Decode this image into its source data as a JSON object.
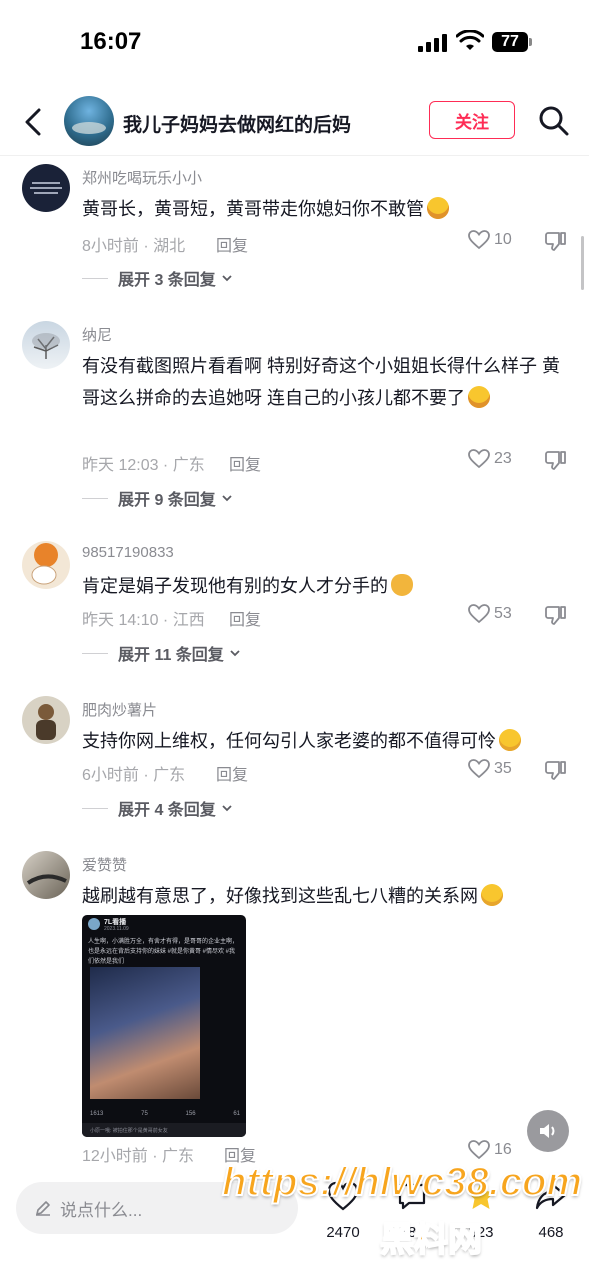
{
  "status_bar": {
    "time": "16:07",
    "battery": "77"
  },
  "header": {
    "title": "我儿子妈妈去做网红的后妈",
    "follow_label": "关注"
  },
  "comments": [
    {
      "user": "郑州吃喝玩乐小小",
      "text": "黄哥长，黄哥短，黄哥带走你媳妇你不敢管",
      "emoji": "rofl-emoji",
      "meta": "8小时前 · 湖北",
      "reply": "回复",
      "likes": "10",
      "expand": "展开 3 条回复"
    },
    {
      "user": "纳尼",
      "text": "有没有截图照片看看啊  特别好奇这个小姐姐长得什么样子  黄哥这么拼命的去追她呀 连自己的小孩儿都不要了",
      "emoji": "grimace-emoji",
      "meta": "昨天 12:03 · 广东",
      "reply": "回复",
      "likes": "23",
      "expand": "展开 9 条回复"
    },
    {
      "user": "98517190833",
      "text": "肯定是娟子发现他有别的女人才分手的",
      "emoji": "money-bag-emoji",
      "meta": "昨天 14:10 · 江西",
      "reply": "回复",
      "likes": "53",
      "expand": "展开 11 条回复"
    },
    {
      "user": "肥肉炒薯片",
      "text": "支持你网上维权，任何勾引人家老婆的都不值得可怜",
      "emoji": "smile-emoji",
      "meta": "6小时前 · 广东",
      "reply": "回复",
      "likes": "35",
      "expand": "展开 4 条回复"
    },
    {
      "user": "爱赞赞",
      "text": "越刷越有意思了，好像找到这些乱七八糟的关系网",
      "emoji": "wink-emoji",
      "meta": "12小时前 · 广东",
      "reply": "回复",
      "likes": "16"
    }
  ],
  "embedded_post": {
    "user": "7L看播",
    "date": "2023.11.09",
    "caption": "人生啊，小满胜万全，有舍才有得，是哥哥的企业主啊，也是永远在背后支持你的妹妹 #就是你黄哥 #情尽欢 #我们依然是我们",
    "stats": [
      "1613",
      "75",
      "156",
      "61"
    ],
    "comment_preview": "小原一哦: 被拍住那个是黄哥前女友"
  },
  "bottom_bar": {
    "input_placeholder": "说点什么...",
    "counts": [
      "2470",
      "388",
      "823",
      "468"
    ]
  },
  "watermark": {
    "url": "https://hlwc38.com",
    "name": "黑料网"
  },
  "colors": {
    "accent": "#fe2c55",
    "watermark": "#f7a51e"
  }
}
